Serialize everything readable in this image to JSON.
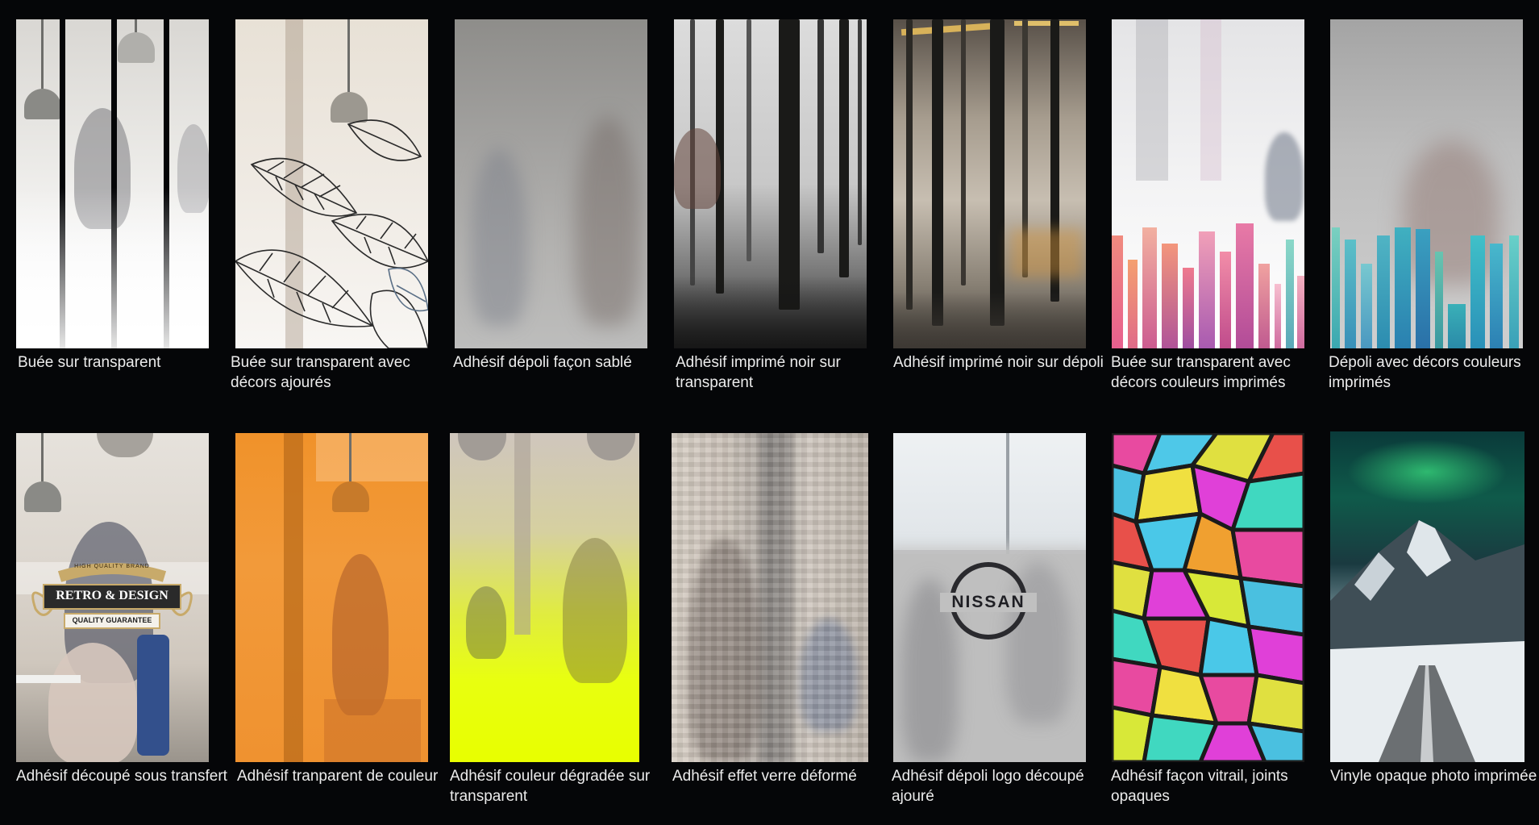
{
  "row1": [
    {
      "id": "buee-transparent",
      "caption": "Buée sur transparent"
    },
    {
      "id": "buee-decors-ajoures",
      "caption": "Buée sur transparent avec décors ajourés"
    },
    {
      "id": "depoli-sable",
      "caption": "Adhésif dépoli façon sablé"
    },
    {
      "id": "imprime-noir-transparent",
      "caption": "Adhésif imprimé noir sur transparent"
    },
    {
      "id": "imprime-noir-depoli",
      "caption": "Adhésif imprimé noir sur dépoli"
    },
    {
      "id": "buee-decors-couleurs",
      "caption": "Buée sur transparent avec décors couleurs imprimés"
    },
    {
      "id": "depoli-decors-couleurs",
      "caption": "Dépoli avec décors couleurs imprimés"
    }
  ],
  "row2": [
    {
      "id": "decoupe-transfert",
      "caption": "Adhésif découpé sous transfert"
    },
    {
      "id": "transparent-couleur",
      "caption": "Adhésif tranparent de couleur"
    },
    {
      "id": "couleur-degradee",
      "caption": "Adhésif couleur dégradée sur transparent"
    },
    {
      "id": "verre-deforme",
      "caption": "Adhésif effet verre déformé"
    },
    {
      "id": "depoli-logo",
      "caption": "Adhésif dépoli logo découpé ajouré"
    },
    {
      "id": "vitrail",
      "caption": "Adhésif façon vitrail, joints opaques"
    },
    {
      "id": "vinyle-photo",
      "caption": "Vinyle opaque photo imprimée"
    }
  ],
  "logos": {
    "retro_top": "HIGH QUALITY BRAND",
    "retro_main": "RETRO & DESIGN",
    "retro_sub": "QUALITY GUARANTEE",
    "nissan": "NISSAN"
  }
}
